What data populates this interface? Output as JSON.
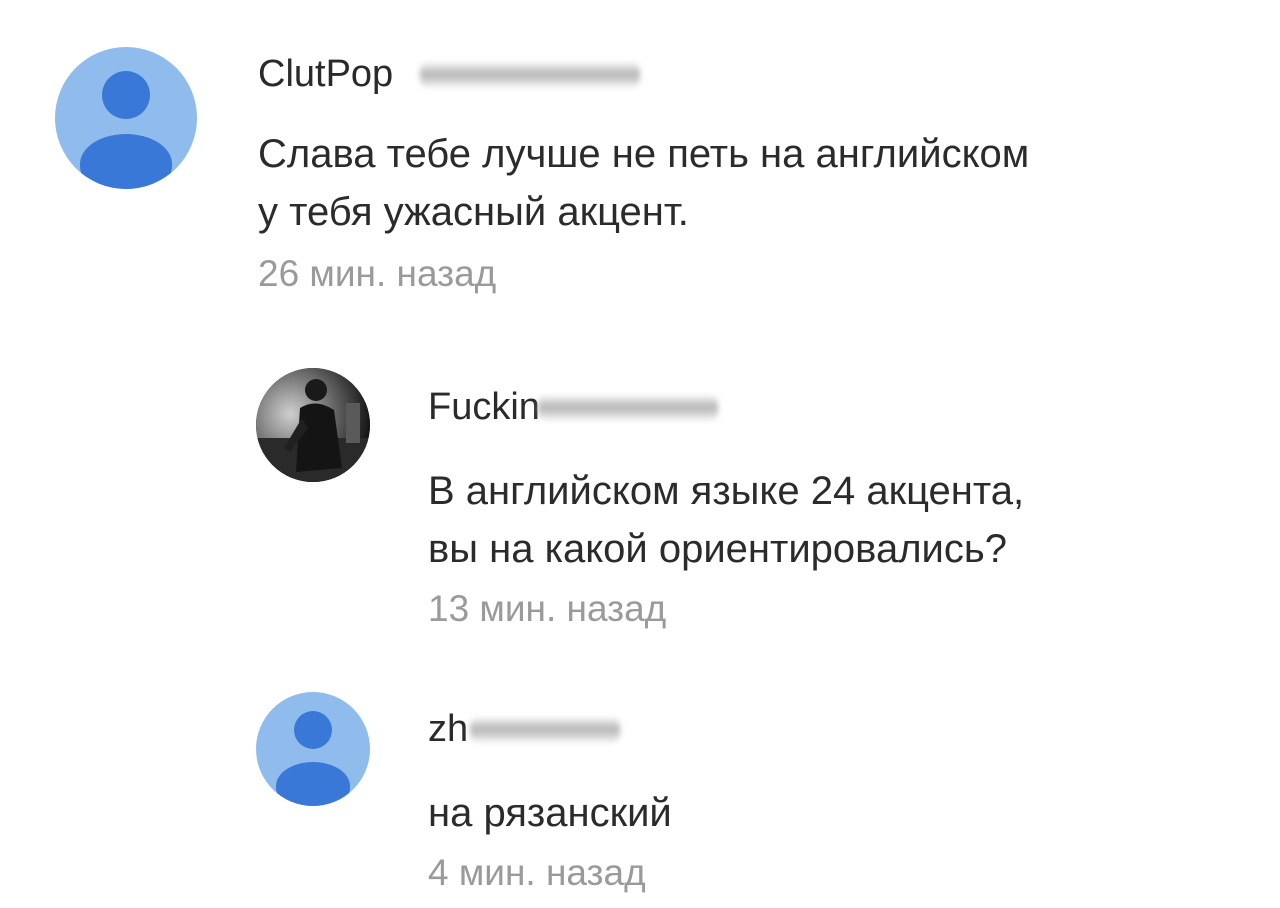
{
  "comments": [
    {
      "author": "ClutPop",
      "text_lines": [
        "Слава тебе лучше не петь на английском",
        "у тебя ужасный акцент."
      ],
      "time": "26 мин. назад",
      "avatar_icon": "default-user-icon"
    },
    {
      "author": "Fuckin",
      "text_lines": [
        "В английском языке 24 акцента,",
        "вы на какой ориентировались?"
      ],
      "time": "13 мин. назад",
      "avatar_icon": "photo-avatar"
    },
    {
      "author": "zh",
      "text_lines": [
        "на рязанский"
      ],
      "time": "4 мин. назад",
      "avatar_icon": "default-user-icon"
    }
  ],
  "colors": {
    "avatar_bg": "#8fbcec",
    "avatar_figure": "#3a78d8",
    "text": "#2b2b2b",
    "timestamp": "#9a9a9a"
  }
}
